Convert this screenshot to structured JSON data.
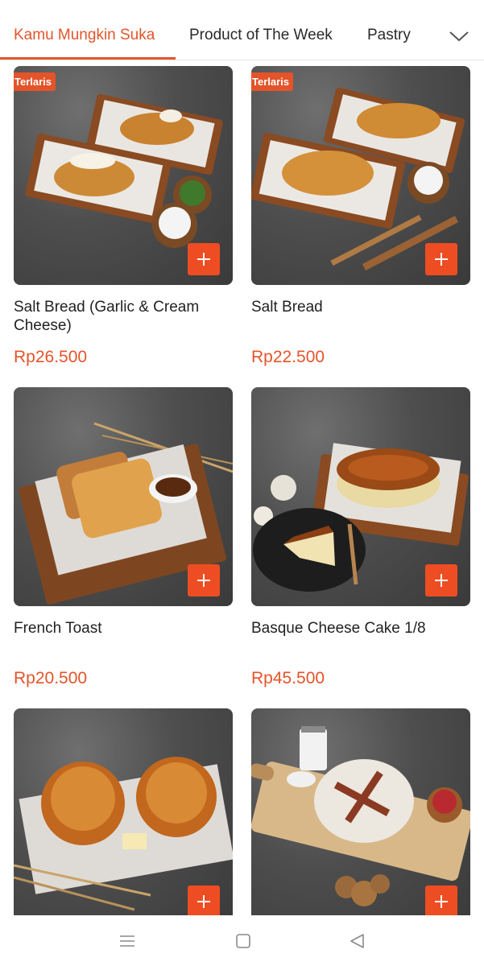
{
  "tabs": [
    {
      "label": "Kamu Mungkin Suka",
      "active": true
    },
    {
      "label": "Product of The Week",
      "active": false
    },
    {
      "label": "Pastry",
      "active": false
    }
  ],
  "tabs_more_icon": "chevron-down-icon",
  "accent_color": "#e4542a",
  "products": [
    {
      "name": "Salt Bread (Garlic & Cream Cheese)",
      "price": "Rp26.500",
      "badge": "Terlaris",
      "image": "salt-bread-garlic-cream-cheese-photo"
    },
    {
      "name": "Salt Bread",
      "price": "Rp22.500",
      "badge": "Terlaris",
      "image": "salt-bread-photo"
    },
    {
      "name": "French Toast",
      "price": "Rp20.500",
      "badge": "",
      "image": "french-toast-photo"
    },
    {
      "name": "Basque Cheese Cake 1/8",
      "price": "Rp45.500",
      "badge": "",
      "image": "basque-cheese-cake-photo"
    },
    {
      "name": "",
      "price": "",
      "badge": "",
      "image": "cheese-bun-photo"
    },
    {
      "name": "",
      "price": "",
      "badge": "",
      "image": "cranberry-walnut-sourdough-photo"
    }
  ],
  "add_button_icon": "plus-icon",
  "system_nav": {
    "menu_icon": "menu-icon",
    "home_icon": "home-icon",
    "back_icon": "back-icon"
  }
}
